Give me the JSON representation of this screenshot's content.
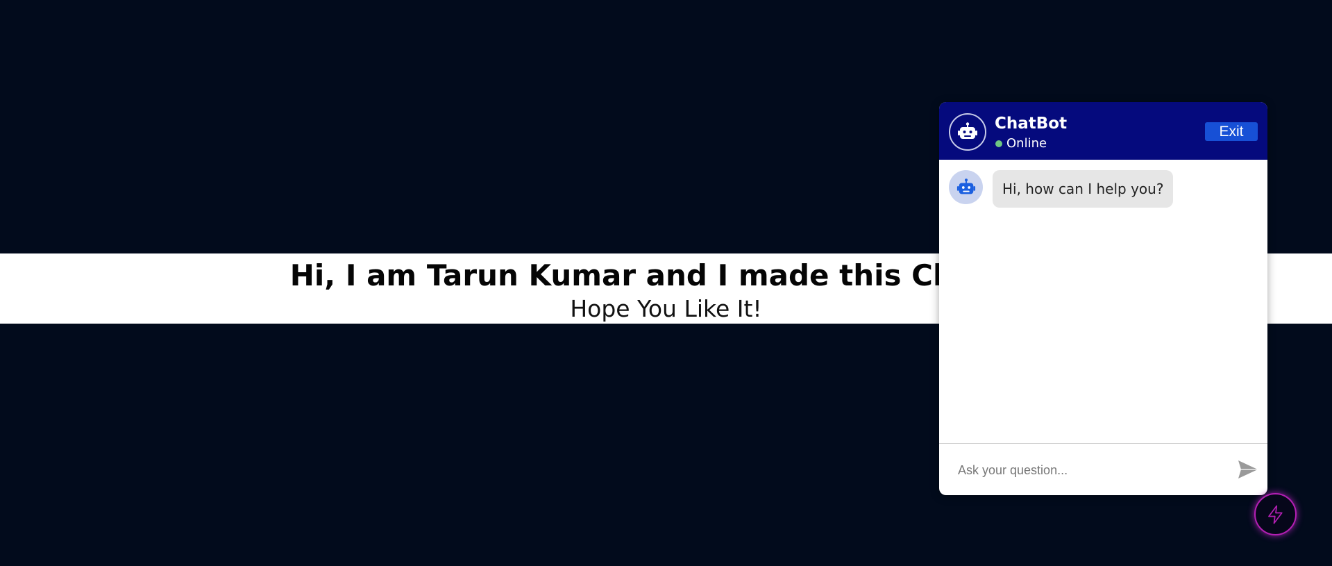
{
  "banner": {
    "title": "Hi, I am Tarun Kumar and I made this Chatbot",
    "subtitle": "Hope You Like It!"
  },
  "chat": {
    "header": {
      "bot_name": "ChatBot",
      "status": "Online",
      "exit_label": "Exit"
    },
    "messages": [
      {
        "sender": "bot",
        "text": "Hi, how can I help you?"
      }
    ],
    "input": {
      "placeholder": "Ask your question...",
      "value": ""
    }
  },
  "icons": {
    "header_avatar": "robot-icon",
    "message_avatar": "robot-icon",
    "send": "send-icon",
    "launcher": "bolt-icon"
  },
  "colors": {
    "page_background": "#020b1c",
    "header_background": "#050a7d",
    "exit_button": "#1750d6",
    "status_online": "#6ec782",
    "bubble_background": "#e6e6e6",
    "launcher_accent": "#b31fb3"
  }
}
